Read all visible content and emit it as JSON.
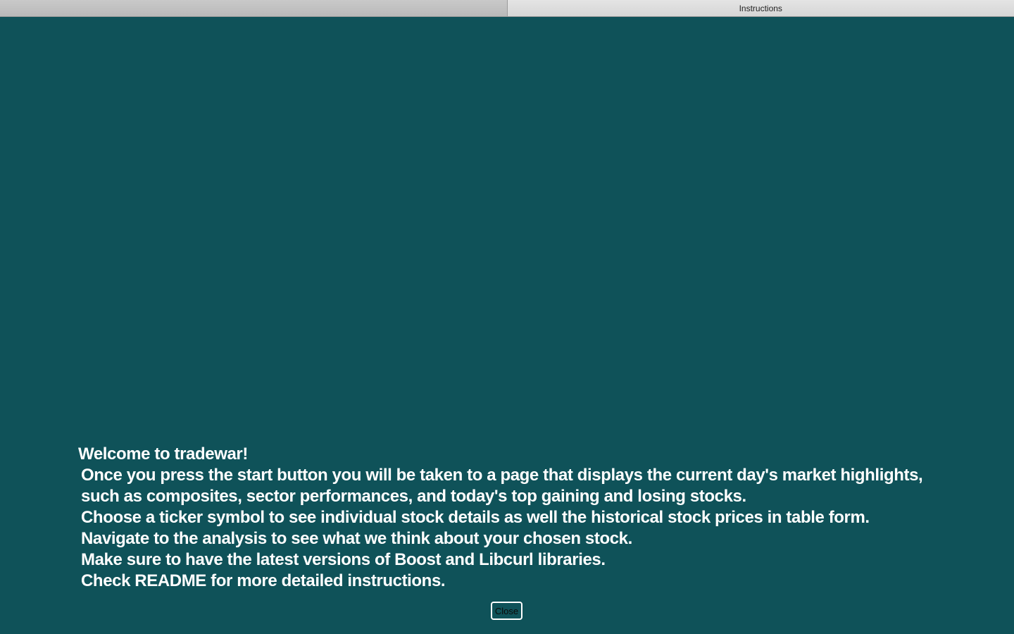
{
  "tabs": [
    {
      "label": ""
    },
    {
      "label": "Instructions"
    }
  ],
  "instructions": {
    "heading": "Welcome to tradewar!",
    "lines": [
      "Once you press the start button you will be taken to a page that displays the current day's market highlights,",
      "such as composites, sector performances, and today's top gaining and losing stocks.",
      "Choose a ticker symbol to see individual stock details as well the historical stock prices in table form.",
      "Navigate to the analysis to see what we think about your chosen stock.",
      "Make sure to have the latest versions of Boost and Libcurl libraries.",
      "Check README for more detailed instructions."
    ]
  },
  "close_button": {
    "label": "Close"
  },
  "colors": {
    "background": "#0f5259",
    "text": "#ffffff"
  }
}
